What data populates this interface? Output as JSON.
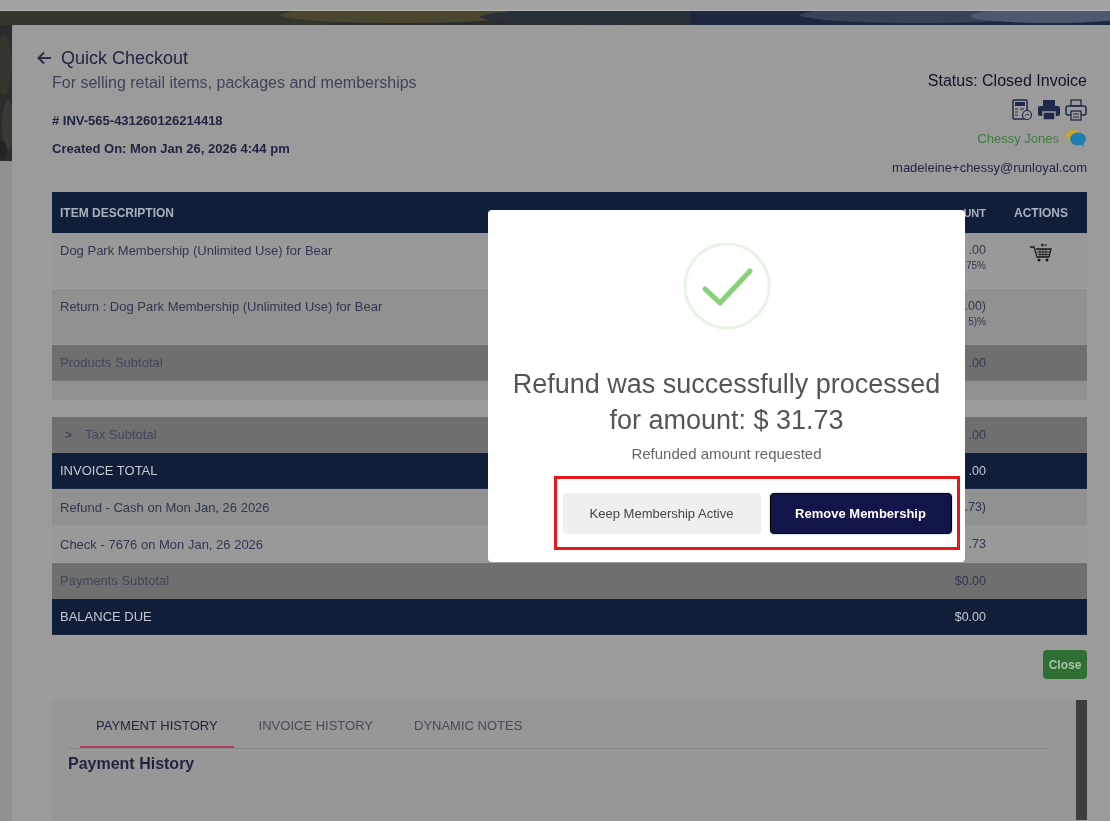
{
  "header": {
    "title": "Quick Checkout",
    "subtitle": "For selling retail items, packages and memberships",
    "invoice_number": "# INV-565-431260126214418",
    "created_on": "Created On: Mon Jan 26, 2026 4:44 pm",
    "status": "Status: Closed Invoice",
    "customer_name": "Chessy Jones",
    "email": "madeleine+chessy@runloyal.com"
  },
  "table": {
    "columns": [
      "ITEM DESCRIPTION",
      "UNT",
      "ACTIONS"
    ],
    "rows": [
      {
        "kind": "item",
        "description": "Dog Park Membership (Unlimited Use) for Bear",
        "amount": ".00",
        "amount_note": "75%",
        "returnable": true
      },
      {
        "kind": "item",
        "description": "Return : Dog Park Membership (Unlimited Use) for Bear",
        "amount": ".00)",
        "amount_note": "5)%",
        "returnable": false
      },
      {
        "kind": "subtotal",
        "description": "Products Subtotal",
        "amount": ".00"
      },
      {
        "kind": "spacer"
      },
      {
        "kind": "tax",
        "expander": ">",
        "description": "Tax Subtotal",
        "amount": ".00"
      },
      {
        "kind": "total",
        "description": "INVOICE TOTAL",
        "amount": ".00"
      },
      {
        "kind": "payment",
        "description": "Refund - Cash on Mon Jan, 26 2026",
        "amount": ".73)"
      },
      {
        "kind": "payment",
        "description": "Check - 7676 on Mon Jan, 26 2026",
        "amount": ".73"
      },
      {
        "kind": "subtotal",
        "description": "Payments Subtotal",
        "amount": "$0.00"
      },
      {
        "kind": "total",
        "description": "BALANCE DUE",
        "amount": "$0.00"
      }
    ]
  },
  "close_button": "Close",
  "tabs": [
    {
      "label": "PAYMENT HISTORY",
      "selected": true
    },
    {
      "label": "INVOICE HISTORY",
      "selected": false
    },
    {
      "label": "DYNAMIC NOTES",
      "selected": false
    }
  ],
  "section_title": "Payment History",
  "modal": {
    "title": "Refund was successfully processed for amount: $ 31.73",
    "message": "Refunded amount requested",
    "buttons_highlighted": true,
    "buttons": [
      {
        "kind": "secondary",
        "label": "Keep Membership Active"
      },
      {
        "kind": "primary",
        "label": "Remove Membership"
      }
    ]
  }
}
